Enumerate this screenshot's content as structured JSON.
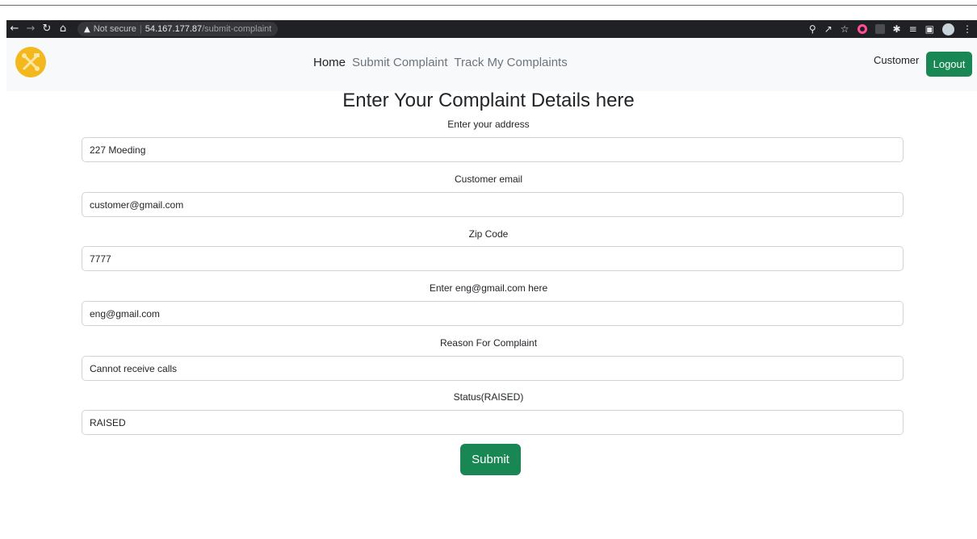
{
  "browser": {
    "security_label": "Not secure",
    "url_host": "54.167.177.87",
    "url_path": "/submit-complaint"
  },
  "navbar": {
    "links": [
      {
        "label": "Home"
      },
      {
        "label": "Submit Complaint"
      },
      {
        "label": "Track My Complaints"
      }
    ],
    "role_label": "Customer",
    "logout_label": "Logout",
    "logo_color": "#f3b81e"
  },
  "form": {
    "title": "Enter Your Complaint Details here",
    "fields": [
      {
        "label": "Enter your address",
        "value": "227 Moeding"
      },
      {
        "label": "Customer email",
        "value": "customer@gmail.com"
      },
      {
        "label": "Zip Code",
        "value": "7777"
      },
      {
        "label": "Enter eng@gmail.com here",
        "value": "eng@gmail.com"
      },
      {
        "label": "Reason For Complaint",
        "value": "Cannot receive calls"
      },
      {
        "label": "Status(RAISED)",
        "value": "RAISED"
      }
    ],
    "submit_label": "Submit"
  },
  "colors": {
    "primary_button": "#198754",
    "navbar_bg": "#f8f9fa"
  }
}
